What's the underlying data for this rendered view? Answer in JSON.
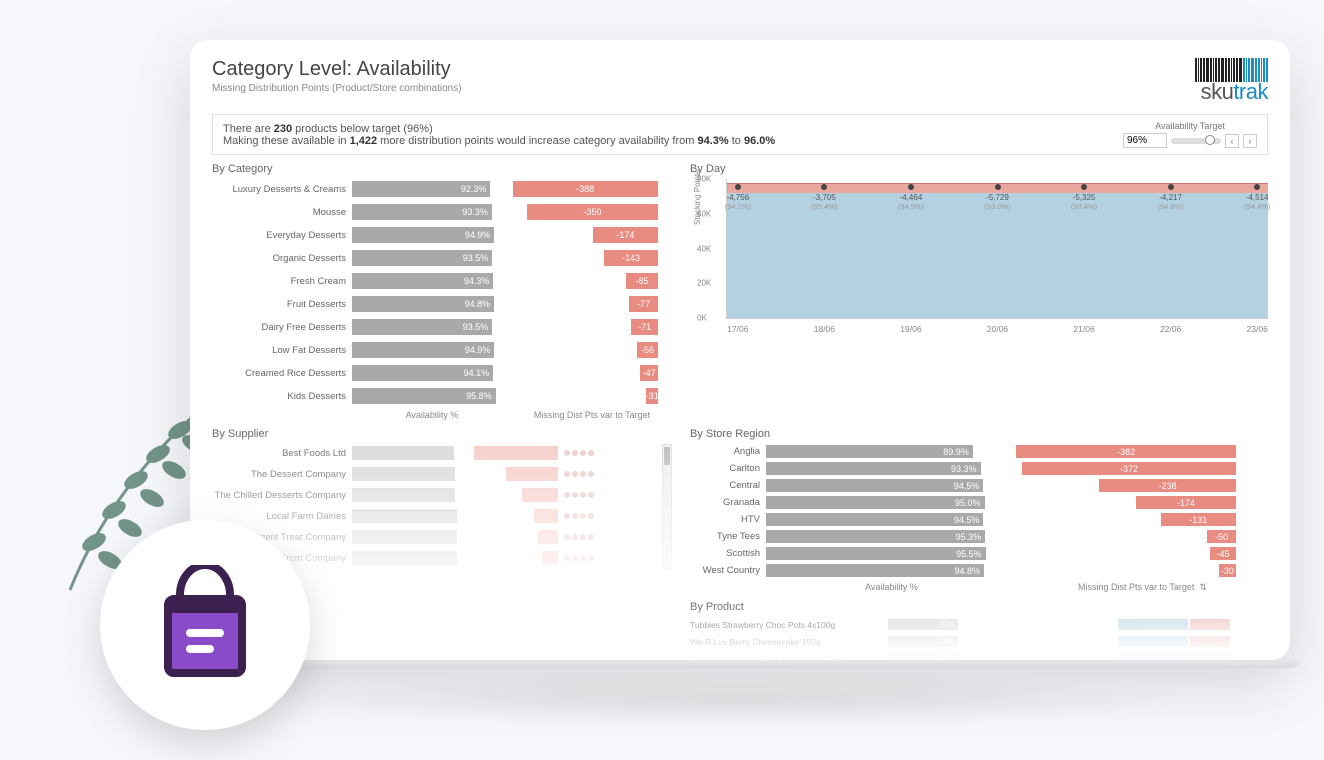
{
  "header": {
    "title": "Category Level: Availability",
    "subtitle": "Missing Distribution Points (Product/Store combinations)",
    "logo_text_a": "sku",
    "logo_text_b": "trak"
  },
  "banner": {
    "line1_a": "There are ",
    "line1_b": "230",
    "line1_c": " products below target (96%)",
    "line2_a": "Making these available in ",
    "line2_b": "1,422",
    "line2_c": " more distribution points would increase category availability from ",
    "line2_d": "94.3%",
    "line2_e": " to ",
    "line2_f": "96.0%",
    "target_label": "Availability Target",
    "target_value": "96%"
  },
  "sections": {
    "by_category": "By Category",
    "by_supplier": "By Supplier",
    "by_day": "By Day",
    "by_region": "By Store Region",
    "by_product": "By Product",
    "axis_avail": "Availability %",
    "axis_miss": "Missing Dist Pts var to Target"
  },
  "chart_data": {
    "by_category": {
      "type": "bar",
      "xlabel_left": "Availability %",
      "xlabel_right": "Missing Dist Pts var to Target",
      "series": [
        {
          "name": "Luxury Desserts & Creams",
          "availability": 92.3,
          "missing": -388
        },
        {
          "name": "Mousse",
          "availability": 93.3,
          "missing": -350
        },
        {
          "name": "Everyday Desserts",
          "availability": 94.9,
          "missing": -174
        },
        {
          "name": "Organic Desserts",
          "availability": 93.5,
          "missing": -143
        },
        {
          "name": "Fresh Cream",
          "availability": 94.3,
          "missing": -85
        },
        {
          "name": "Fruit Desserts",
          "availability": 94.8,
          "missing": -77
        },
        {
          "name": "Dairy Free Desserts",
          "availability": 93.5,
          "missing": -71
        },
        {
          "name": "Low Fat Desserts",
          "availability": 94.9,
          "missing": -56
        },
        {
          "name": "Creamed Rice Desserts",
          "availability": 94.1,
          "missing": -47
        },
        {
          "name": "Kids Desserts",
          "availability": 95.8,
          "missing": -31
        }
      ]
    },
    "by_supplier": {
      "type": "bar",
      "series": [
        {
          "name": "Best Foods Ltd",
          "availability": 93.0,
          "missing": -420
        },
        {
          "name": "The Dessert Company",
          "availability": 94.0,
          "missing": -260
        },
        {
          "name": "The Chilled Desserts Company",
          "availability": 94.0,
          "missing": -180
        },
        {
          "name": "Local Farm Dairies",
          "availability": 95.0,
          "missing": -120
        },
        {
          "name": "Indulgent Treat Company",
          "availability": 95.0,
          "missing": -100
        },
        {
          "name": "Free From Company",
          "availability": 95.0,
          "missing": -80
        }
      ]
    },
    "by_day": {
      "type": "area",
      "ylabel": "Stocking Points",
      "yticks": [
        0,
        20000,
        40000,
        60000,
        80000
      ],
      "ytick_labels": [
        "0K",
        "20K",
        "40K",
        "60K",
        "80K"
      ],
      "points": [
        {
          "x": "17/06",
          "missing": -4756,
          "pct": 94.1
        },
        {
          "x": "18/06",
          "missing": -3705,
          "pct": 95.4
        },
        {
          "x": "19/06",
          "missing": -4464,
          "pct": 94.5
        },
        {
          "x": "20/06",
          "missing": -5729,
          "pct": 93.0
        },
        {
          "x": "21/06",
          "missing": -5325,
          "pct": 93.4
        },
        {
          "x": "22/06",
          "missing": -4217,
          "pct": 94.8
        },
        {
          "x": "23/06",
          "missing": -4514,
          "pct": 94.4
        }
      ]
    },
    "by_region": {
      "type": "bar",
      "xlabel_left": "Availability %",
      "xlabel_right": "Missing Dist Pts var to Target",
      "series": [
        {
          "name": "Anglia",
          "availability": 89.9,
          "missing": -382
        },
        {
          "name": "Carlton",
          "availability": 93.3,
          "missing": -372
        },
        {
          "name": "Central",
          "availability": 94.5,
          "missing": -238
        },
        {
          "name": "Granada",
          "availability": 95.0,
          "missing": -174
        },
        {
          "name": "HTV",
          "availability": 94.5,
          "missing": -131
        },
        {
          "name": "Tyne Tees",
          "availability": 95.3,
          "missing": -50
        },
        {
          "name": "Scottish",
          "availability": 95.5,
          "missing": -45
        },
        {
          "name": "West Country",
          "availability": 94.8,
          "missing": -30
        }
      ]
    },
    "by_product": {
      "type": "bar",
      "series": [
        {
          "name": "Tubbies Strawberry Choc Pots 4x100g",
          "availability": 70.0
        },
        {
          "name": "We R Lux Berry Cheesecake 150g",
          "availability": 74.0
        },
        {
          "name": "Own Label Variety Pack Mousse 4x125g",
          "availability": 72.0
        }
      ]
    }
  }
}
